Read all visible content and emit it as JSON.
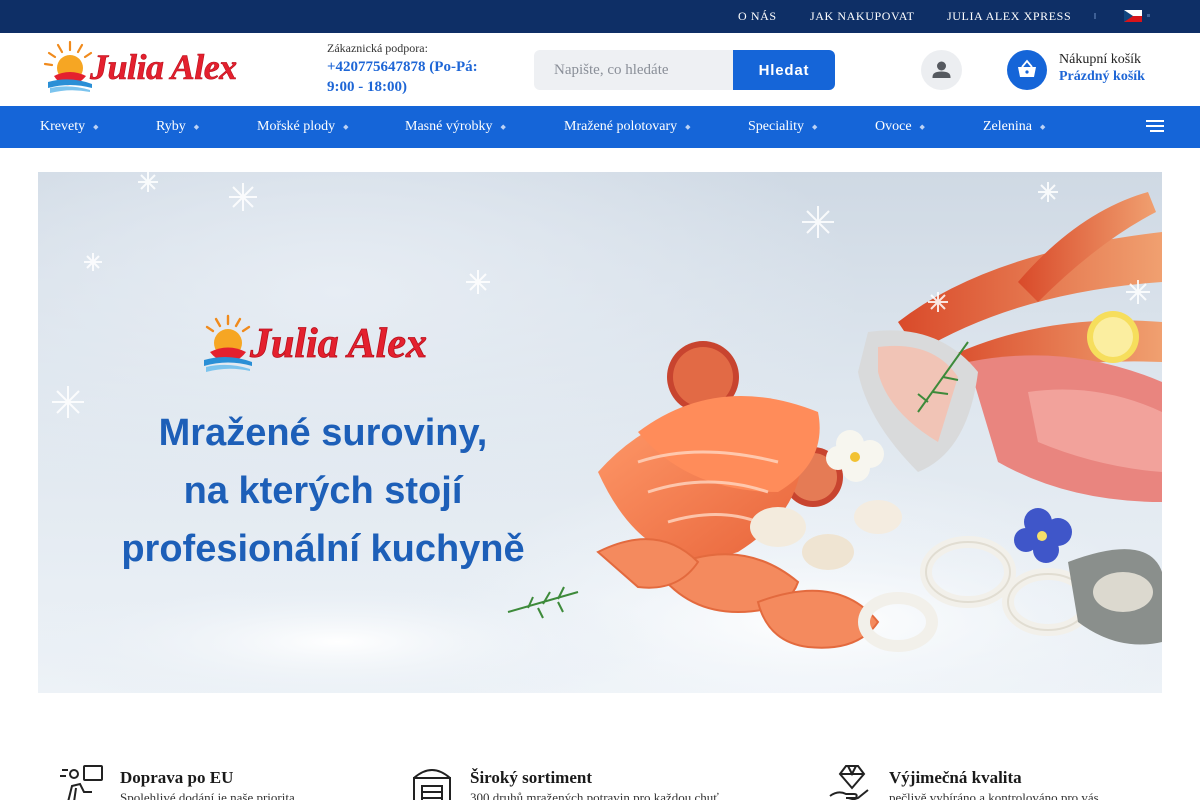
{
  "topbar": {
    "links": [
      "O NÁS",
      "JAK NAKUPOVAT",
      "JULIA ALEX XPRESS"
    ],
    "language": "cs"
  },
  "header": {
    "logo_text": "Julia Alex",
    "support_label": "Zákaznická podpora:",
    "support_phone": "+420775647878 (Po-Pá: 9:00 - 18:00)",
    "search_placeholder": "Napište, co hledáte",
    "search_button": "Hledat",
    "cart_label": "Nákupní košík",
    "cart_status": "Prázdný košík"
  },
  "nav": {
    "items": [
      {
        "label": "Krevety"
      },
      {
        "label": "Ryby"
      },
      {
        "label": "Mořské plody"
      },
      {
        "label": "Masné výrobky"
      },
      {
        "label": "Mražené polotovary"
      },
      {
        "label": "Speciality"
      },
      {
        "label": "Ovoce"
      },
      {
        "label": "Zelenina"
      }
    ]
  },
  "hero": {
    "logo_text": "Julia Alex",
    "headline": [
      "Mražené suroviny,",
      "na kterých stojí",
      "profesionální kuchyně"
    ]
  },
  "features": [
    {
      "title": "Doprava po EU",
      "desc": "Spolehlivé dodání je naše priorita",
      "icon": "delivery-icon"
    },
    {
      "title": "Široký sortiment",
      "desc": "300 druhů mražených potravin pro každou chuť",
      "icon": "store-icon"
    },
    {
      "title": "Výjimečná kvalita",
      "desc": "pečlivě vybíráno a kontrolováno pro vás",
      "icon": "diamond-hand-icon"
    }
  ],
  "colors": {
    "topbar": "#0e2f66",
    "primary": "#1565d8",
    "logo_red": "#e4202e",
    "headline_blue": "#1d5fb8"
  }
}
